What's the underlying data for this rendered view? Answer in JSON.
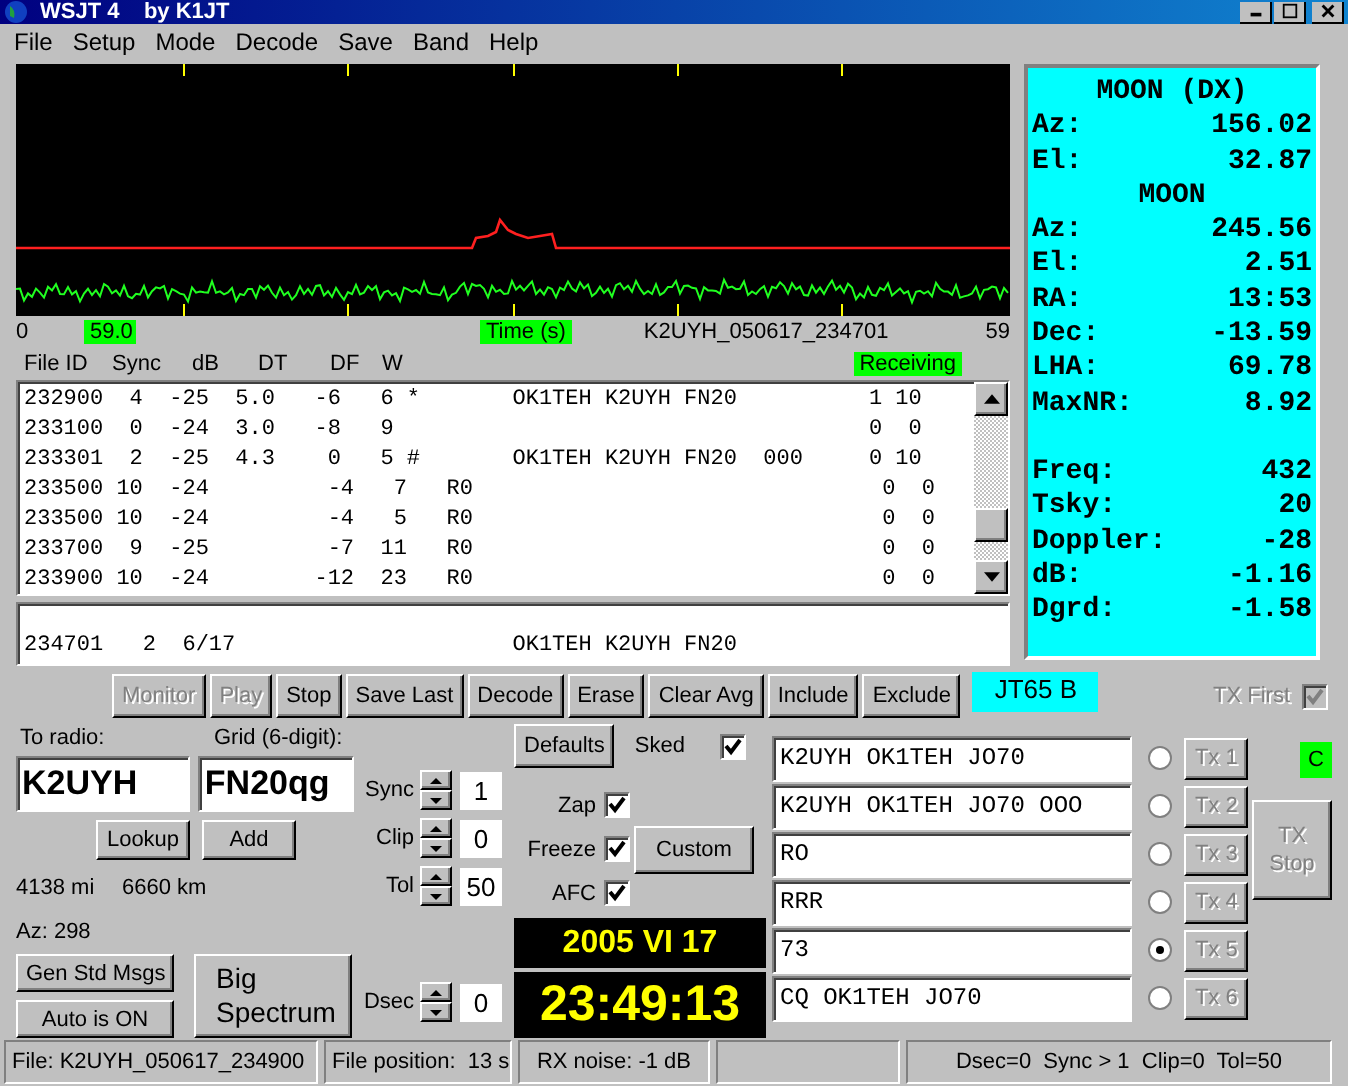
{
  "window": {
    "title": "WSJT 4    by K1JT"
  },
  "menu": [
    "File",
    "Setup",
    "Mode",
    "Decode",
    "Save",
    "Band",
    "Help"
  ],
  "plot": {
    "axis_start": "0",
    "marker": "59.0",
    "axis_label": "Time (s)",
    "file_name": "K2UYH_050617_234701",
    "axis_end": "59"
  },
  "decode_list": {
    "columns": [
      "File ID",
      "Sync",
      "dB",
      "DT",
      "DF",
      "W"
    ],
    "status": "Receiving",
    "rows": [
      "232900  4  -25  5.0   -6   6 *       OK1TEH K2UYH FN20          1 10",
      "233100  0  -24  3.0   -8   9                                    0  0",
      "233301  2  -25  4.3    0   5 #       OK1TEH K2UYH FN20  000     0 10",
      "233500 10  -24         -4   7   R0                               0  0",
      "233500 10  -24         -4   5   R0                               0  0",
      "233700  9  -25         -7  11   R0                               0  0",
      "233900 10  -24        -12  23   R0                               0  0"
    ]
  },
  "average_list": {
    "rows": [
      "234701   2  6/17                     OK1TEH K2UYH FN20"
    ]
  },
  "buttons": [
    {
      "label": "Monitor",
      "disabled": true
    },
    {
      "label": "Play",
      "disabled": true
    },
    {
      "label": "Stop",
      "disabled": false
    },
    {
      "label": "Save Last",
      "disabled": false
    },
    {
      "label": "Decode",
      "disabled": false
    },
    {
      "label": "Erase",
      "disabled": false
    },
    {
      "label": "Clear Avg",
      "disabled": false
    },
    {
      "label": "Include",
      "disabled": false
    },
    {
      "label": "Exclude",
      "disabled": false
    }
  ],
  "mode": "JT65 B",
  "tx_first": {
    "label": "TX First",
    "checked": true,
    "disabled": true
  },
  "station": {
    "to_radio_label": "To radio:",
    "to_radio": "K2UYH",
    "grid_label": "Grid (6-digit):",
    "grid": "FN20qg",
    "lookup": "Lookup",
    "add": "Add",
    "distance_mi": "4138 mi",
    "distance_km": "6660 km",
    "azimuth": "Az: 298"
  },
  "left_buttons": [
    "Gen Std Msgs",
    "Auto is ON"
  ],
  "big_spectrum": "Big Spectrum",
  "spinners": [
    {
      "label": "Sync",
      "value": "1"
    },
    {
      "label": "Clip",
      "value": "0"
    },
    {
      "label": "Tol",
      "value": "50"
    }
  ],
  "dsec": {
    "label": "Dsec",
    "value": "0"
  },
  "defaults": "Defaults",
  "sked": {
    "label": "Sked",
    "checked": true
  },
  "options": [
    {
      "label": "Zap",
      "checked": true
    },
    {
      "label": "Freeze",
      "checked": true
    },
    {
      "label": "AFC",
      "checked": true
    }
  ],
  "custom": "Custom",
  "date": "2005 VI 17",
  "time": "23:49:13",
  "tx_messages": [
    {
      "text": "K2UYH OK1TEH JO70",
      "selected": false,
      "button": "Tx 1",
      "disabled": true
    },
    {
      "text": "K2UYH OK1TEH JO70 OOO",
      "selected": false,
      "button": "Tx 2",
      "disabled": true
    },
    {
      "text": "RO",
      "selected": false,
      "button": "Tx 3",
      "disabled": true
    },
    {
      "text": "RRR",
      "selected": false,
      "button": "Tx 4",
      "disabled": true
    },
    {
      "text": "73",
      "selected": true,
      "button": "Tx 5",
      "disabled": true
    },
    {
      "text": "CQ OK1TEH JO70",
      "selected": false,
      "button": "Tx 6",
      "disabled": true
    }
  ],
  "indicator": "C",
  "tx_stop": {
    "label": "TX Stop",
    "disabled": true
  },
  "moon": [
    {
      "kind": "heading",
      "label": "MOON (DX)"
    },
    {
      "kind": "value",
      "label": "Az:",
      "value": "156.02"
    },
    {
      "kind": "value",
      "label": "El:",
      "value": "32.87"
    },
    {
      "kind": "heading",
      "label": "MOON"
    },
    {
      "kind": "value",
      "label": "Az:",
      "value": "245.56"
    },
    {
      "kind": "value",
      "label": "El:",
      "value": "2.51"
    },
    {
      "kind": "value",
      "label": "RA:",
      "value": "13:53"
    },
    {
      "kind": "value",
      "label": "Dec:",
      "value": "-13.59"
    },
    {
      "kind": "value",
      "label": "LHA:",
      "value": "69.78"
    },
    {
      "kind": "value",
      "label": "MaxNR:",
      "value": "8.92"
    },
    {
      "kind": "value",
      "label": "Freq:",
      "value": "432",
      "gap_before": true
    },
    {
      "kind": "value",
      "label": "Tsky:",
      "value": "20"
    },
    {
      "kind": "value",
      "label": "Doppler:",
      "value": "-28"
    },
    {
      "kind": "value",
      "label": "dB:",
      "value": "-1.16"
    },
    {
      "kind": "value",
      "label": "Dgrd:",
      "value": "-1.58"
    }
  ],
  "status_bar": {
    "file": "File: K2UYH_050617_234900",
    "position": "File position:  13 s",
    "noise": "RX noise: -1 dB",
    "settings": "Dsec=0  Sync > 1  Clip=0  Tol=50"
  }
}
